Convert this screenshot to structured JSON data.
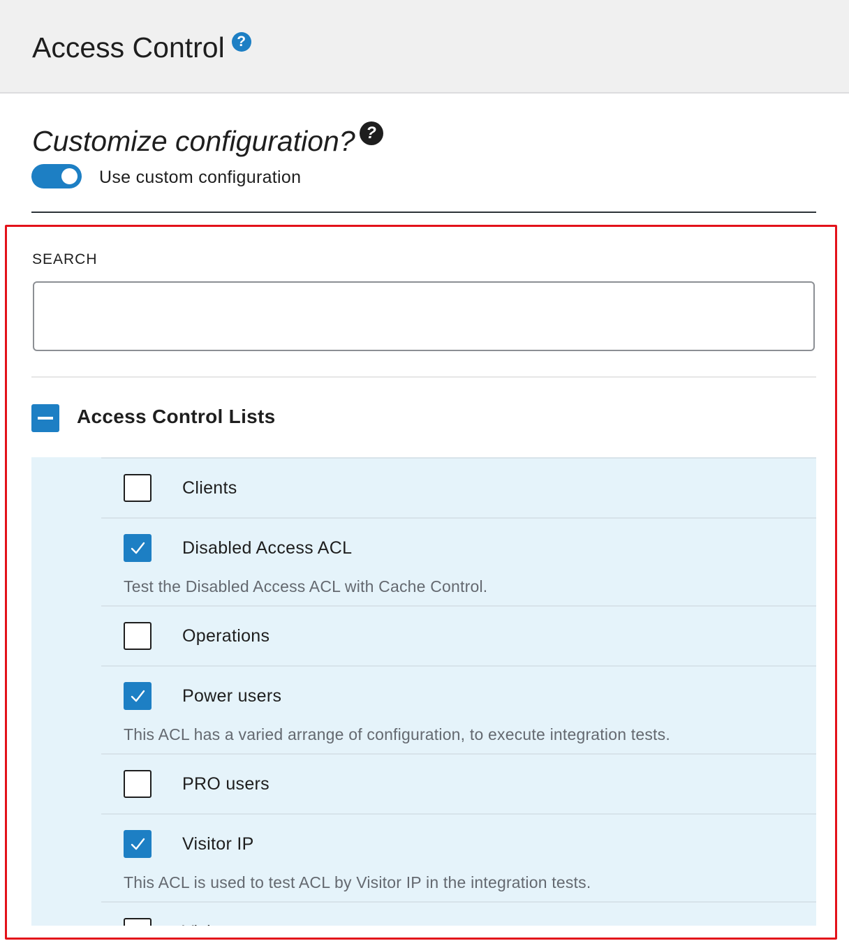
{
  "header": {
    "title": "Access Control",
    "help_glyph": "?"
  },
  "customize": {
    "title": "Customize configuration?",
    "help_glyph": "?",
    "toggle_label": "Use custom configuration",
    "toggle_on": true
  },
  "search": {
    "label": "SEARCH",
    "value": "",
    "placeholder": ""
  },
  "acl_group": {
    "title": "Access Control Lists",
    "state": "indeterminate",
    "items": [
      {
        "label": "Clients",
        "checked": false,
        "description": ""
      },
      {
        "label": "Disabled Access ACL",
        "checked": true,
        "description": "Test the Disabled Access ACL with Cache Control."
      },
      {
        "label": "Operations",
        "checked": false,
        "description": ""
      },
      {
        "label": "Power users",
        "checked": true,
        "description": "This ACL has a varied arrange of configuration, to execute integration tests."
      },
      {
        "label": "PRO users",
        "checked": false,
        "description": ""
      },
      {
        "label": "Visitor IP",
        "checked": true,
        "description": "This ACL is used to test ACL by Visitor IP in the integration tests."
      },
      {
        "label": "Visitors",
        "checked": false,
        "description": ""
      }
    ]
  },
  "colors": {
    "accent": "#1d7fc4",
    "list_background": "#e5f3fa",
    "highlight_border": "#e3121a"
  }
}
